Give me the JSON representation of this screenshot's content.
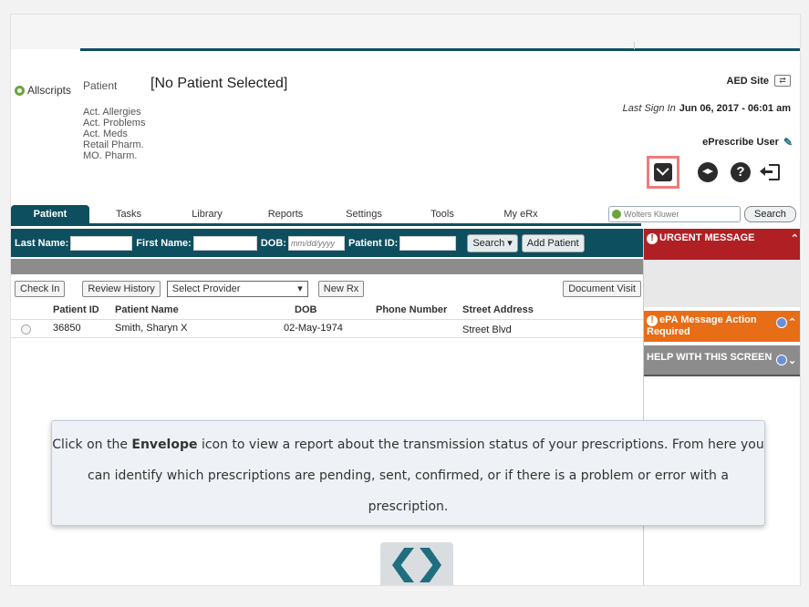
{
  "header": {
    "brand": "Allscripts",
    "patient_label": "Patient",
    "patient_value": "[No Patient Selected]",
    "quicklinks": [
      "Act. Allergies",
      "Act. Problems",
      "Act. Meds",
      "Retail Pharm.",
      "MO. Pharm."
    ],
    "site": "AED Site",
    "last_sign_in_label": "Last Sign In",
    "last_sign_in_value": "Jun 06, 2017 - 06:01  am",
    "user": "ePrescribe User"
  },
  "icons": [
    "envelope-icon",
    "graduation-cap-icon",
    "help-icon",
    "logout-icon"
  ],
  "nav": {
    "tabs": [
      "Patient",
      "Tasks",
      "Library",
      "Reports",
      "Settings",
      "Tools",
      "My eRx"
    ],
    "active": "Patient",
    "search_placeholder": "Wolters Kluwer",
    "search_button": "Search"
  },
  "filter": {
    "last_name_label": "Last Name:",
    "first_name_label": "First Name:",
    "dob_label": "DOB:",
    "dob_placeholder": "mm/dd/yyyy",
    "patient_id_label": "Patient ID:",
    "search_button": "Search",
    "add_patient_button": "Add Patient"
  },
  "toolbar": {
    "check_in": "Check In",
    "review_history": "Review History",
    "select_provider": "Select Provider",
    "new_rx": "New Rx",
    "document_visit": "Document Visit"
  },
  "grid": {
    "columns": [
      "Patient ID",
      "Patient Name",
      "DOB",
      "Phone Number",
      "Street Address"
    ],
    "rows": [
      {
        "patient_id": "36850",
        "patient_name": "Smith, Sharyn X",
        "dob": "02-May-1974",
        "phone": "",
        "address": "Street Blvd"
      }
    ]
  },
  "side": {
    "urgent": "URGENT MESSAGE",
    "epa_line1": "ePA Message Action",
    "epa_line2": "Required",
    "help": "HELP WITH THIS SCREEN"
  },
  "callout": {
    "pre": "Click on the ",
    "bold": "Envelope",
    "post": " icon to view a report about the transmission status of your prescriptions.  From here you can identify which prescriptions are pending, sent, confirmed, or if there is a problem or error with a prescription."
  },
  "colors": {
    "teal": "#0e4f5f",
    "urgent_red": "#b01f24",
    "epa_orange": "#e86d17",
    "highlight": "#ee7b7b"
  }
}
